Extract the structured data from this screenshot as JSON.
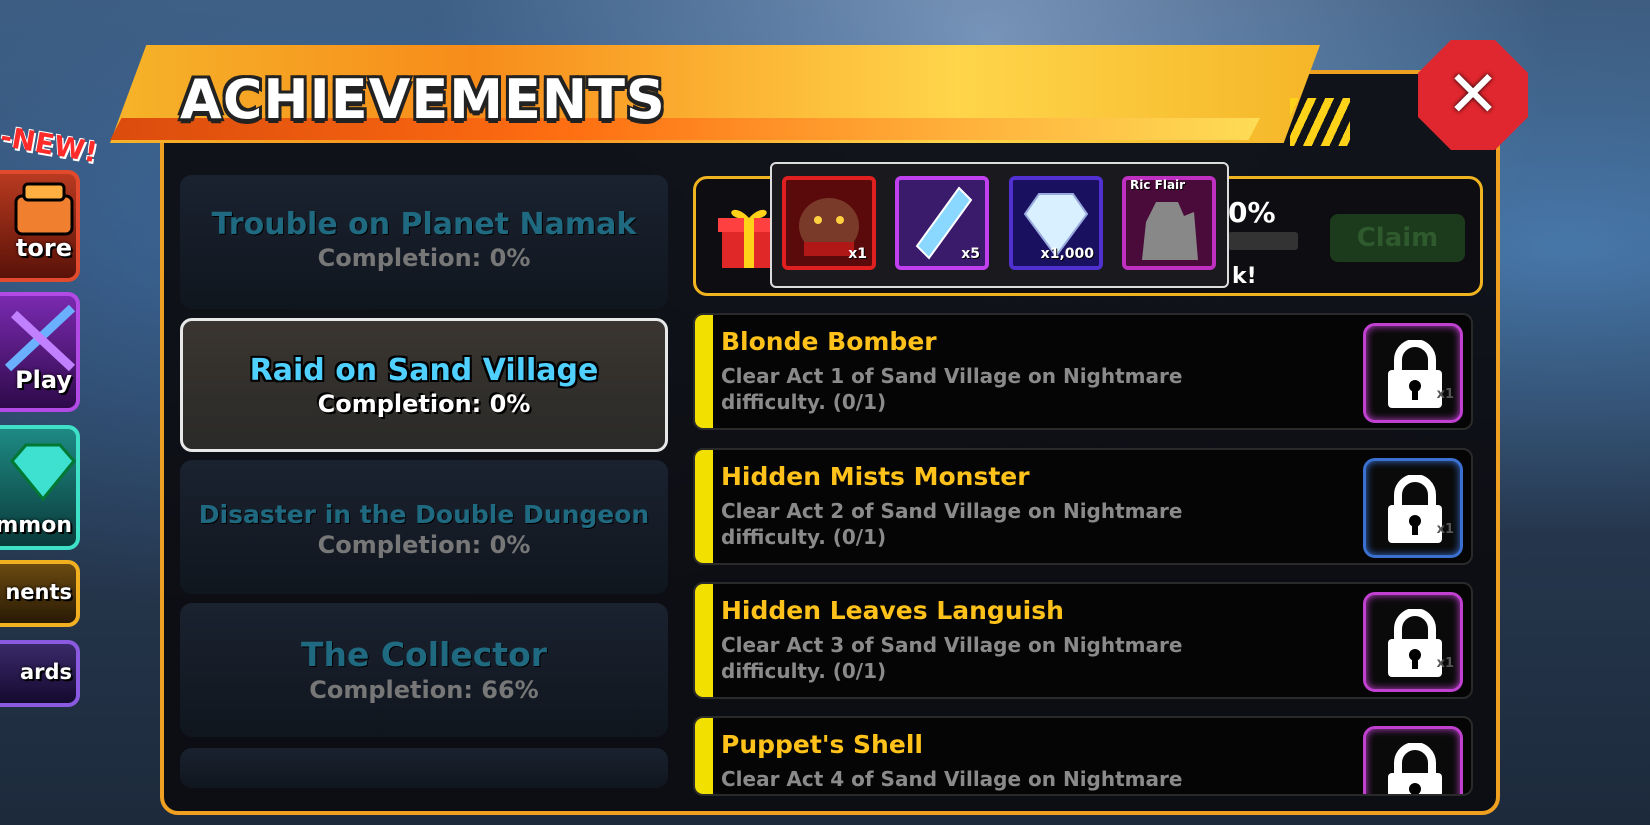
{
  "header": {
    "title": "ACHIEVEMENTS",
    "close_label": "✕"
  },
  "side_menu": {
    "new_tag": "-NEW!",
    "items": [
      {
        "label": "tore",
        "icon": "store-icon"
      },
      {
        "label": "Play",
        "icon": "swords-icon"
      },
      {
        "label": "mmon",
        "icon": "gem-icon"
      },
      {
        "label": "nents"
      },
      {
        "label": "ards"
      }
    ]
  },
  "categories": [
    {
      "title": "Trouble on Planet Namak",
      "completion": "Completion: 0%"
    },
    {
      "title": "Raid on Sand Village",
      "completion": "Completion: 0%",
      "selected": true
    },
    {
      "title": "Disaster in the Double Dungeon",
      "completion": "Completion: 0%"
    },
    {
      "title": "The Collector",
      "completion": "Completion: 66%"
    }
  ],
  "summary": {
    "percent": "0%",
    "progress": 0,
    "claim_label": "Claim",
    "text_tail": "k!",
    "rewards": [
      {
        "qty": "x1",
        "icon": "creature-icon",
        "color": "#e02020"
      },
      {
        "qty": "x5",
        "icon": "crystal-shard-icon",
        "color": "#c040f0"
      },
      {
        "qty": "x1,000",
        "icon": "gem-icon",
        "color": "#5030d0"
      },
      {
        "qty": "",
        "name": "Ric Flair",
        "icon": "unit-silhouette-icon",
        "color": "#c030c0"
      }
    ]
  },
  "achievements": [
    {
      "title": "Blonde Bomber",
      "desc": "Clear Act 1 of Sand Village on Nightmare difficulty. (0/1)",
      "reward_qty": "x1",
      "frame_color": "#c040d0"
    },
    {
      "title": "Hidden Mists Monster",
      "desc": "Clear Act 2 of Sand Village on Nightmare difficulty. (0/1)",
      "reward_qty": "x1",
      "frame_color": "#3a70d0"
    },
    {
      "title": "Hidden Leaves Languish",
      "desc": "Clear Act 3 of Sand Village on Nightmare difficulty. (0/1)",
      "reward_qty": "x1",
      "frame_color": "#c040d0"
    },
    {
      "title": "Puppet's Shell",
      "desc": "Clear Act 4 of Sand Village on Nightmare",
      "reward_qty": "",
      "frame_color": "#c040d0"
    }
  ],
  "colors": {
    "accent": "#f0a020",
    "card_bar": "#f2e000",
    "title_yellow": "#ffc21a",
    "close_red": "#e0262e"
  }
}
